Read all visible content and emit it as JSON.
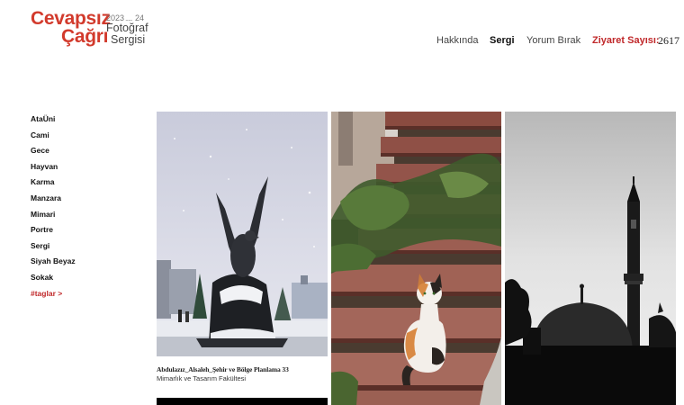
{
  "logo": {
    "line1": "Cevapsız",
    "line2": "Çağrı",
    "year_start": "2023",
    "year_sep": ".....",
    "year_end": "24",
    "sub1": "Fotoğraf",
    "sub2": "Sergisi"
  },
  "nav": {
    "about": "Hakkında",
    "gallery": "Sergi",
    "comment": "Yorum Bırak",
    "visits_label": "Ziyaret Sayısı:",
    "visits_count": "2617"
  },
  "sidebar": {
    "items": [
      {
        "label": "AtaÜni"
      },
      {
        "label": "Cami"
      },
      {
        "label": "Gece"
      },
      {
        "label": "Hayvan"
      },
      {
        "label": "Karma"
      },
      {
        "label": "Manzara"
      },
      {
        "label": "Mimari"
      },
      {
        "label": "Portre"
      },
      {
        "label": "Sergi"
      },
      {
        "label": "Siyah Beyaz"
      },
      {
        "label": "Sokak"
      }
    ],
    "tags_link": "#taglar >"
  },
  "gallery": {
    "photos": [
      {
        "id_label": "eagle-statue-snow",
        "caption_title": "Abdulazız_Alsaleh_Şehir ve Bölge Planlama 33",
        "caption_sub": "Mimarlık ve Tasarım Fakültesi"
      },
      {
        "id_label": "cat-on-stairs"
      },
      {
        "id_label": "mosque-silhouette"
      }
    ]
  },
  "colors": {
    "brand_red": "#d23a2c",
    "nav_red": "#c0282a"
  }
}
